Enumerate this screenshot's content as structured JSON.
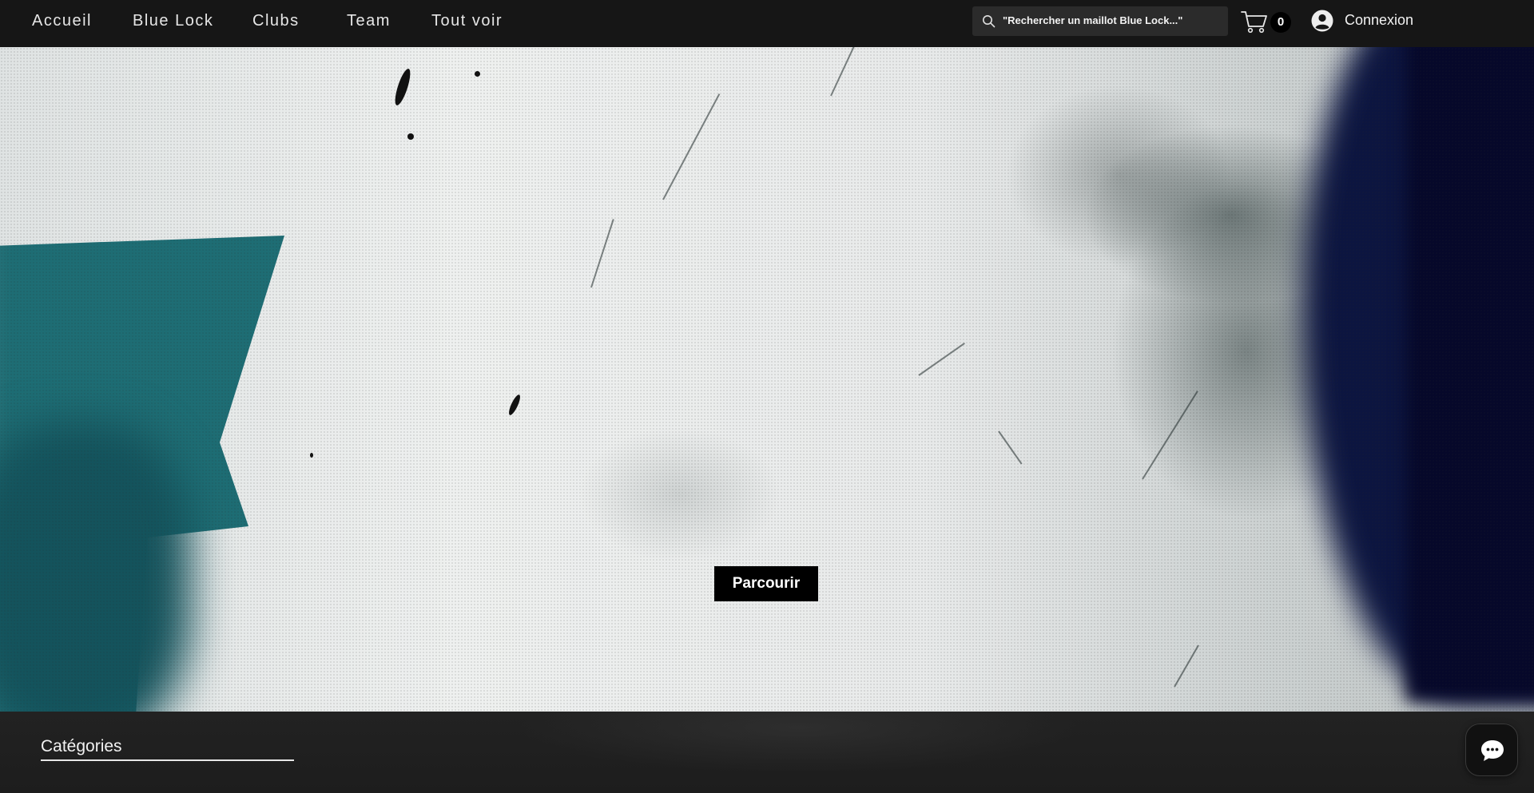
{
  "nav": {
    "items": [
      {
        "label": "Accueil"
      },
      {
        "label": "Blue Lock"
      },
      {
        "label": "Clubs"
      },
      {
        "label": "Team"
      },
      {
        "label": "Tout voir"
      }
    ]
  },
  "search": {
    "placeholder": "\"Rechercher un maillot Blue Lock...\"",
    "icon": "search-icon"
  },
  "cart": {
    "count": "0",
    "icon": "cart-icon"
  },
  "account": {
    "login_label": "Connexion",
    "icon": "avatar-icon"
  },
  "hero": {
    "button_label": "Parcourir"
  },
  "categories": {
    "title": "Catégories"
  },
  "chat": {
    "icon": "chat-icon"
  },
  "colors": {
    "topbar": "#161616",
    "button": "#000000",
    "teal": "#1e6d74",
    "navy": "#0c1540"
  }
}
